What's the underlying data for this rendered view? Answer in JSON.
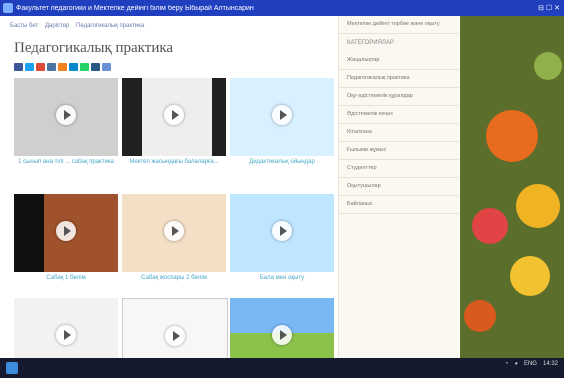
{
  "window": {
    "title": "Факультет педагогики и Мектепке дейінгі білім беру Ыбырай Алтынсарин"
  },
  "breadcrumbs": [
    "Басты бет",
    "Дәрістер",
    "Педагогикалық практика"
  ],
  "page": {
    "title": "Педагогикалық практика"
  },
  "videos": [
    {
      "caption": "1 сынып ана тілі ... сабақ практика"
    },
    {
      "caption": "Мектеп жасындағы балаларға..."
    },
    {
      "caption": "Дидактикалық ойындар"
    },
    {
      "caption": "Сабақ 1 бөлім"
    },
    {
      "caption": "Сабақ жоспары 2 бөлім"
    },
    {
      "caption": "Бала мен оқыту"
    },
    {
      "caption": ""
    },
    {
      "caption": ""
    },
    {
      "caption": ""
    }
  ],
  "sidebar": {
    "top": "Мектепке дейінгі тәрбие және оқыту",
    "heading": "КАТЕГОРИЯЛАР",
    "items": [
      "Жаңалықтар",
      "Педагогикалық практика",
      "Оқу-әдістемелік құралдар",
      "Әдістемелік кеңес",
      "Кітапхана",
      "Ғылыми жұмыс",
      "Студенттер",
      "Оқытушылар",
      "Байланыс"
    ]
  },
  "taskbar": {
    "time": "14:32",
    "lang": "ENG"
  }
}
